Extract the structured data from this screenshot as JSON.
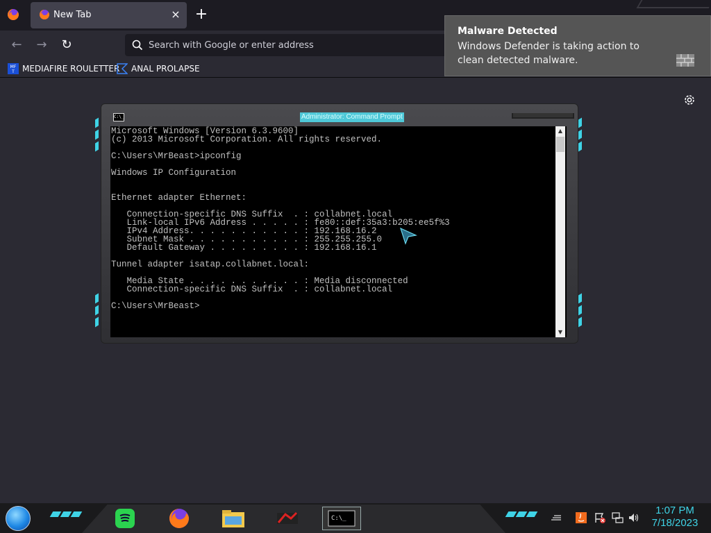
{
  "browser": {
    "tab": {
      "title": "New Tab",
      "close_glyph": "×"
    },
    "new_tab_glyph": "+",
    "nav": {
      "back_glyph": "←",
      "forward_glyph": "→",
      "reload_glyph": "↻"
    },
    "urlbar": {
      "placeholder": "Search with Google or enter address",
      "value": ""
    },
    "bookmarks": [
      {
        "label": "MEDIAFIRE ROULETTER",
        "icon": "mediafire-icon"
      },
      {
        "label": "ANAL PROLAPSE",
        "icon": "bookmark-flag-icon"
      }
    ]
  },
  "notification": {
    "title": "Malware Detected",
    "body": "Windows Defender is taking action to clean detected malware."
  },
  "cmd": {
    "title": "Administrator: Command Prompt",
    "icon_text": "C:\\_",
    "lines": [
      "Microsoft Windows [Version 6.3.9600]",
      "(c) 2013 Microsoft Corporation. All rights reserved.",
      "",
      "C:\\Users\\MrBeast>ipconfig",
      "",
      "Windows IP Configuration",
      "",
      "",
      "Ethernet adapter Ethernet:",
      "",
      "   Connection-specific DNS Suffix  . : collabnet.local",
      "   Link-local IPv6 Address . . . . . : fe80::def:35a3:b205:ee5f%3",
      "   IPv4 Address. . . . . . . . . . . : 192.168.16.2",
      "   Subnet Mask . . . . . . . . . . . : 255.255.255.0",
      "   Default Gateway . . . . . . . . . : 192.168.16.1",
      "",
      "Tunnel adapter isatap.collabnet.local:",
      "",
      "   Media State . . . . . . . . . . . : Media disconnected",
      "   Connection-specific DNS Suffix  . : collabnet.local",
      "",
      "C:\\Users\\MrBeast>"
    ],
    "scroll_up_glyph": "▲",
    "scroll_down_glyph": "▼"
  },
  "taskbar": {
    "apps": [
      "spotify-icon",
      "firefox-icon",
      "file-explorer-icon",
      "game-app-icon",
      "command-prompt-icon"
    ],
    "cmd_app_text": "C:\\_",
    "clock": {
      "time": "1:07 PM",
      "date": "7/18/2023"
    }
  },
  "colors": {
    "accent": "#3fd3e6",
    "chrome_bg": "#2b2a33",
    "tabstrip_bg": "#1c1b22",
    "toast_bg": "#555555"
  }
}
